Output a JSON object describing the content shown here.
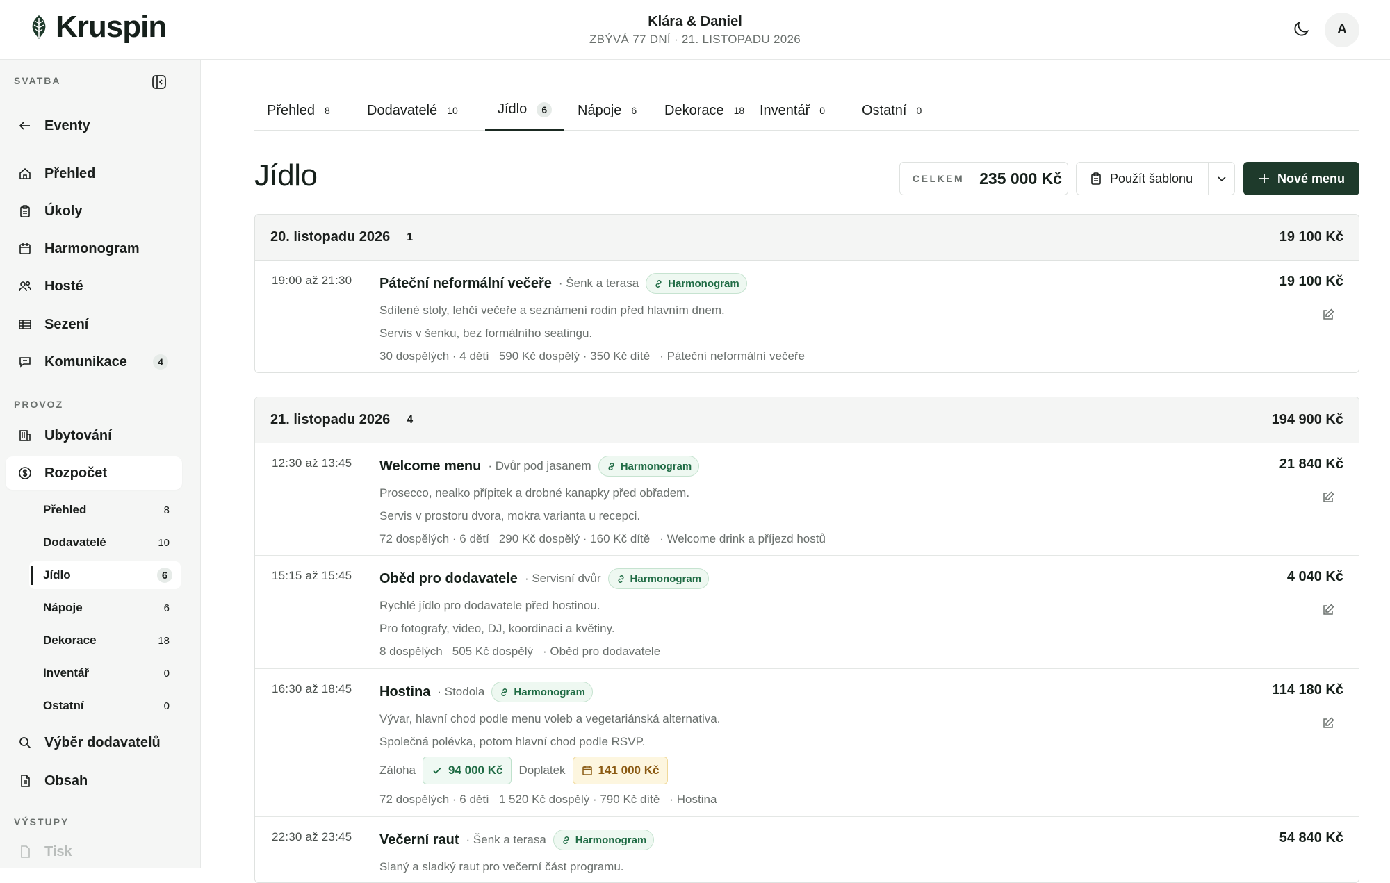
{
  "header": {
    "app_name": "Kruspin",
    "couple": "Klára & Daniel",
    "countdown": "ZBÝVÁ 77 DNÍ · 21. LISTOPADU 2026",
    "avatar_initial": "A"
  },
  "sidebar": {
    "section_wedding": "SVATBA",
    "back_label": "Eventy",
    "items": [
      {
        "label": "Přehled",
        "icon": "home-icon"
      },
      {
        "label": "Úkoly",
        "icon": "clipboard-icon"
      },
      {
        "label": "Harmonogram",
        "icon": "calendar-icon"
      },
      {
        "label": "Hosté",
        "icon": "users-icon"
      },
      {
        "label": "Sezení",
        "icon": "table-icon"
      },
      {
        "label": "Komunikace",
        "icon": "chat-icon",
        "badge": "4"
      }
    ],
    "section_ops": "PROVOZ",
    "ops_items": [
      {
        "label": "Ubytování",
        "icon": "building-icon"
      },
      {
        "label": "Rozpočet",
        "icon": "dollar-icon"
      }
    ],
    "budget_sub": [
      {
        "label": "Přehled",
        "count": "8"
      },
      {
        "label": "Dodavatelé",
        "count": "10"
      },
      {
        "label": "Jídlo",
        "count": "6"
      },
      {
        "label": "Nápoje",
        "count": "6"
      },
      {
        "label": "Dekorace",
        "count": "18"
      },
      {
        "label": "Inventář",
        "count": "0"
      },
      {
        "label": "Ostatní",
        "count": "0"
      }
    ],
    "more_items": [
      {
        "label": "Výběr dodavatelů",
        "icon": "search-icon"
      },
      {
        "label": "Obsah",
        "icon": "document-icon"
      }
    ],
    "section_outputs": "VÝSTUPY",
    "print_label": "Tisk"
  },
  "tabs": [
    {
      "label": "Přehled",
      "count": "8"
    },
    {
      "label": "Dodavatelé",
      "count": "10"
    },
    {
      "label": "Jídlo",
      "count": "6"
    },
    {
      "label": "Nápoje",
      "count": "6"
    },
    {
      "label": "Dekorace",
      "count": "18"
    },
    {
      "label": "Inventář",
      "count": "0"
    },
    {
      "label": "Ostatní",
      "count": "0"
    }
  ],
  "page": {
    "title": "Jídlo",
    "total_label": "CELKEM",
    "total_value": "235 000 Kč",
    "template_button": "Použít šablonu",
    "new_button": "Nové menu"
  },
  "groups": [
    {
      "date": "20. listopadu 2026",
      "count": "1",
      "sum": "19 100 Kč",
      "rows": [
        {
          "time": "19:00 až 21:30",
          "name": "Páteční neformální večeře",
          "location": "· Šenk a terasa",
          "badge": "Harmonogram",
          "desc1": "Sdílené stoly, lehčí večeře a seznámení rodin před hlavním dnem.",
          "desc2": "Servis v šenku, bez formálního seatingu.",
          "meta_people": "30 dospělých · 4 dětí",
          "meta_price": "590 Kč dospělý · 350 Kč dítě",
          "meta_event": "· Páteční neformální večeře",
          "price": "19 100 Kč"
        }
      ]
    },
    {
      "date": "21. listopadu 2026",
      "count": "4",
      "sum": "194 900 Kč",
      "rows": [
        {
          "time": "12:30 až 13:45",
          "name": "Welcome menu",
          "location": "· Dvůr pod jasanem",
          "badge": "Harmonogram",
          "desc1": "Prosecco, nealko přípitek a drobné kanapky před obřadem.",
          "desc2": "Servis v prostoru dvora, mokra varianta u recepci.",
          "meta_people": "72 dospělých · 6 dětí",
          "meta_price": "290 Kč dospělý · 160 Kč dítě",
          "meta_event": "· Welcome drink a příjezd hostů",
          "price": "21 840 Kč"
        },
        {
          "time": "15:15 až 15:45",
          "name": "Oběd pro dodavatele",
          "location": "· Servisní dvůr",
          "badge": "Harmonogram",
          "desc1": "Rychlé jídlo pro dodavatele před hostinou.",
          "desc2": "Pro fotografy, video, DJ, koordinaci a květiny.",
          "meta_people": "8 dospělých",
          "meta_price": "505 Kč dospělý",
          "meta_event": "· Oběd pro dodavatele",
          "price": "4 040 Kč"
        },
        {
          "time": "16:30 až 18:45",
          "name": "Hostina",
          "location": "· Stodola",
          "badge": "Harmonogram",
          "desc1": "Vývar, hlavní chod podle menu voleb a vegetariánská alternativa.",
          "desc2": "Společná polévka, potom hlavní chod podle RSVP.",
          "deposit_label": "Záloha",
          "deposit_value": "94 000 Kč",
          "extra_label": "Doplatek",
          "extra_value": "141 000 Kč",
          "meta_people": "72 dospělých · 6 dětí",
          "meta_price": "1 520 Kč dospělý · 790 Kč dítě",
          "meta_event": "· Hostina",
          "price": "114 180 Kč"
        },
        {
          "time": "22:30 až 23:45",
          "name": "Večerní raut",
          "location": "· Šenk a terasa",
          "badge": "Harmonogram",
          "desc1": "Slaný a sladký raut pro večerní část programu.",
          "price": "54 840 Kč"
        }
      ]
    }
  ]
}
